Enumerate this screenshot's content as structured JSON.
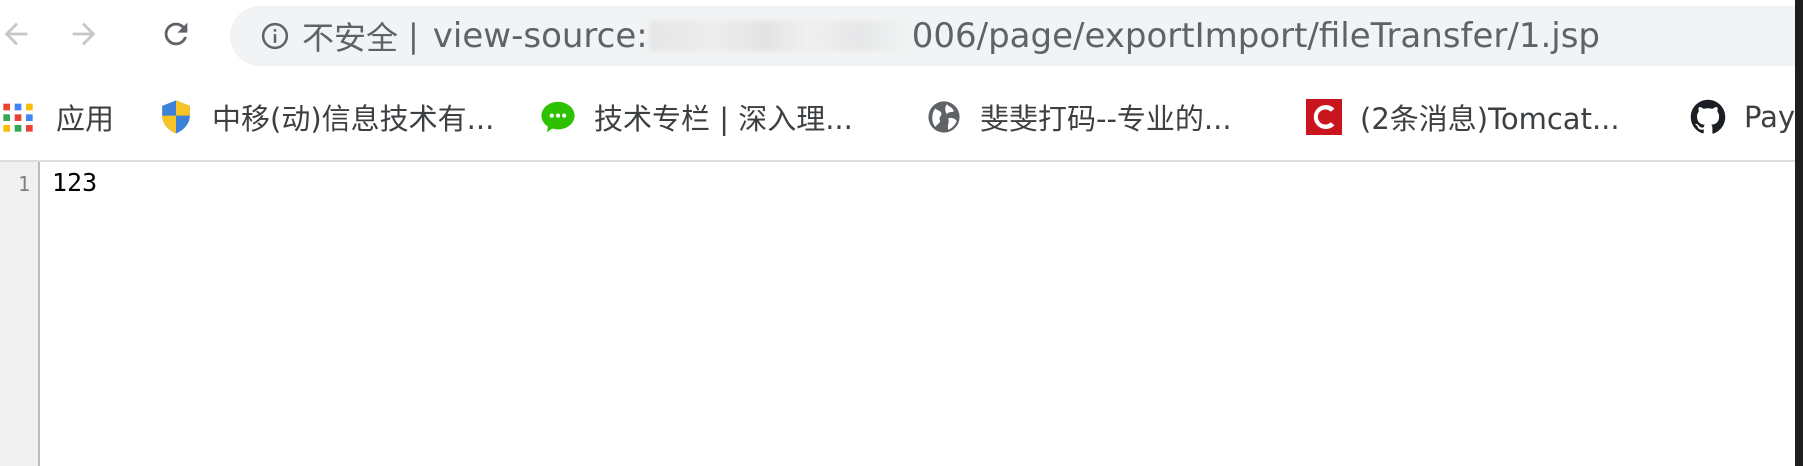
{
  "toolbar": {
    "back_icon": "arrow-left-icon",
    "forward_icon": "arrow-right-icon",
    "reload_icon": "reload-icon"
  },
  "omnibox": {
    "info_icon": "info-icon",
    "security_label": "不安全",
    "separator": "|",
    "url_prefix": "view-source:",
    "url_suffix": "006/page/exportImport/fileTransfer/1.jsp"
  },
  "bookmarks": {
    "items": [
      {
        "label": "应用",
        "icon": "apps-grid-icon"
      },
      {
        "label": "中移(动)信息技术有...",
        "icon": "shield-icon"
      },
      {
        "label": "技术专栏 | 深入理...",
        "icon": "wechat-icon"
      },
      {
        "label": "斐斐打码--专业的...",
        "icon": "globe-icon"
      },
      {
        "label": "(2条消息)Tomcat...",
        "icon": "csdn-icon"
      },
      {
        "label": "Pay",
        "icon": "github-icon"
      }
    ]
  },
  "source": {
    "lines": [
      {
        "number": "1",
        "text": "123"
      }
    ]
  },
  "colors": {
    "chrome_icon": "#5f6368",
    "omnibox_bg": "#f1f3f4",
    "wechat_green": "#2dc100",
    "csdn_red": "#c9151e",
    "shield_blue": "#3b82d8",
    "shield_yellow": "#f7c325"
  }
}
